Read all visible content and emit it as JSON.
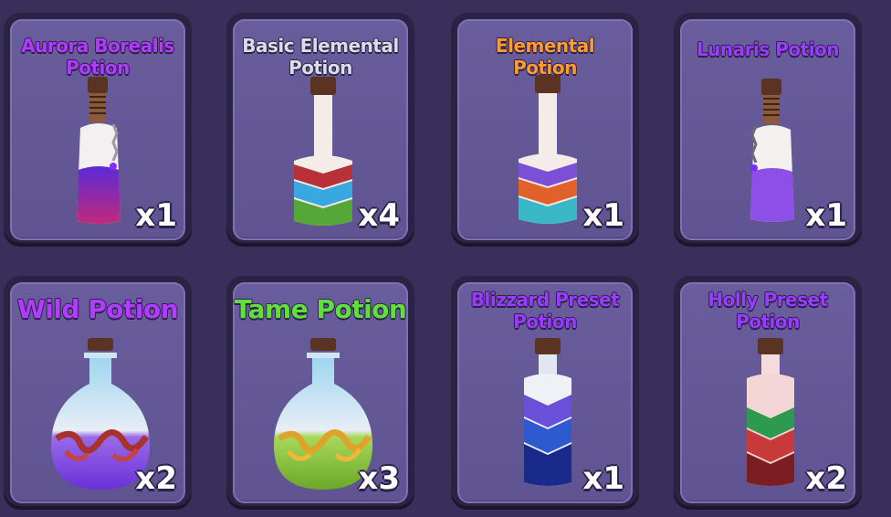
{
  "inventory": {
    "items": [
      {
        "name_line1": "Aurora Borealis",
        "name_line2": "Potion",
        "quantity": "x1",
        "name_color": "#b23bff"
      },
      {
        "name_line1": "Basic Elemental",
        "name_line2": "Potion",
        "quantity": "x4",
        "name_color": "#dcdce6"
      },
      {
        "name_line1": "Elemental",
        "name_line2": "Potion",
        "quantity": "x1",
        "name_color": "#ff9b2f"
      },
      {
        "name": "Lunaris Potion",
        "quantity": "x1",
        "name_color": "#9b3bff"
      },
      {
        "name": "Wild Potion",
        "quantity": "x2",
        "name_color": "#b23bff"
      },
      {
        "name": "Tame Potion",
        "quantity": "x3",
        "name_color": "#5fe03a"
      },
      {
        "name_line1": "Blizzard Preset",
        "name_line2": "Potion",
        "quantity": "x1",
        "name_color": "#9b3bff"
      },
      {
        "name_line1": "Holly Preset",
        "name_line2": "Potion",
        "quantity": "x2",
        "name_color": "#9b3bff"
      }
    ]
  },
  "icons": {
    "aurora": "aurora-borealis-potion-icon",
    "basic_elemental": "basic-elemental-potion-icon",
    "elemental": "elemental-potion-icon",
    "lunaris": "lunaris-potion-icon",
    "wild": "wild-potion-icon",
    "tame": "tame-potion-icon",
    "blizzard": "blizzard-preset-potion-icon",
    "holly": "holly-preset-potion-icon"
  }
}
